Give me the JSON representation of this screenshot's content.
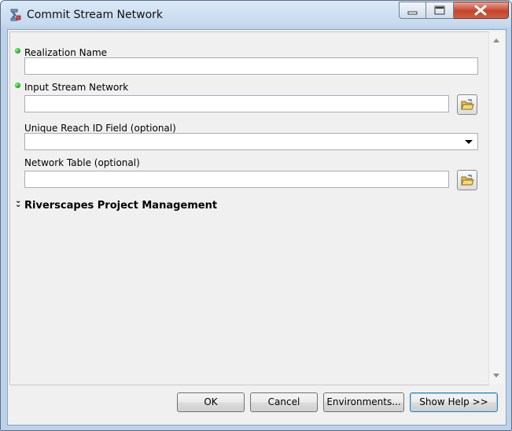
{
  "window": {
    "title": "Commit Stream Network"
  },
  "fields": {
    "realization_name": {
      "label": "Realization Name",
      "value": ""
    },
    "input_stream_network": {
      "label": "Input Stream Network",
      "value": ""
    },
    "unique_reach_id": {
      "label": "Unique Reach ID Field (optional)",
      "value": ""
    },
    "network_table": {
      "label": "Network Table (optional)",
      "value": ""
    }
  },
  "section": {
    "label": "Riverscapes Project Management"
  },
  "buttons": {
    "ok": "OK",
    "cancel": "Cancel",
    "environments": "Environments...",
    "show_help": "Show Help >>"
  },
  "colors": {
    "required_dot": "#14a314",
    "close_button": "#c4442b"
  },
  "icons": [
    "tool-icon",
    "folder-open-icon",
    "minimize-icon",
    "maximize-icon",
    "close-icon",
    "chevron-double-down-icon"
  ]
}
